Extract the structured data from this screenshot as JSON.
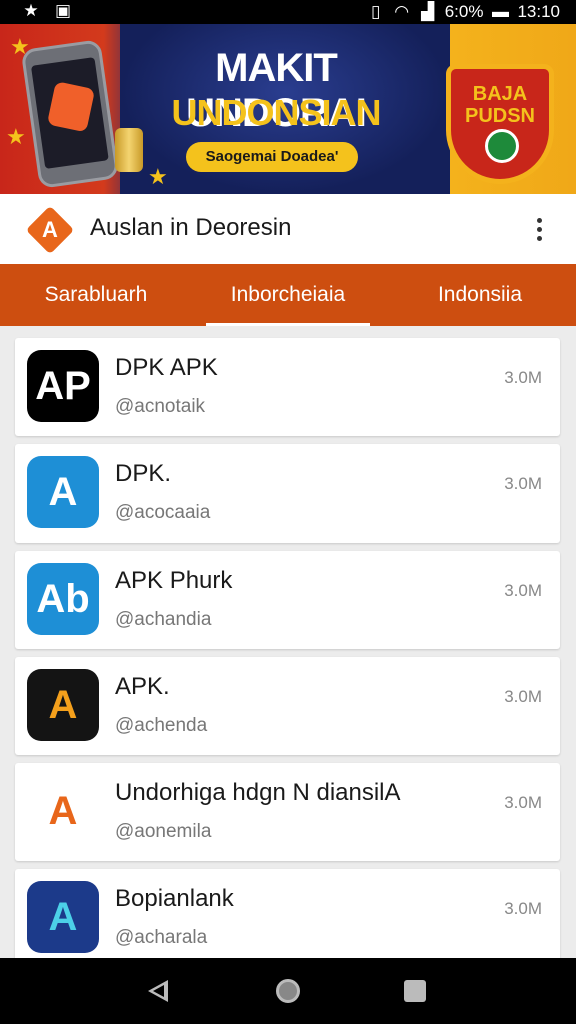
{
  "status_bar": {
    "battery": "6:0%",
    "time": "13:10",
    "icons": [
      "notification-icon",
      "image-icon",
      "vibrate-icon",
      "wifi-icon",
      "signal-icon",
      "battery-icon"
    ]
  },
  "banner": {
    "title_line1": "MAKIT UNDORAI",
    "title_line2": "UNDONSIAN",
    "pill_text": "Saogemai Doadea'",
    "shield_text_line1": "BAJA",
    "shield_text_line2": "PUDSN"
  },
  "app_header": {
    "logo_letter": "A",
    "title": "Auslan in Deoresin",
    "menu_icon": "more-vertical-icon"
  },
  "tabs": [
    {
      "label": "Sarabluarh",
      "active": false
    },
    {
      "label": "Inborcheiaia",
      "active": true
    },
    {
      "label": "Indonsiia",
      "active": false
    }
  ],
  "apps": [
    {
      "name": "DPK APK",
      "developer": "@acnotaik",
      "size": "3.0M",
      "icon_text": "AP",
      "icon_bg": "#000000",
      "icon_color": "#ffffff"
    },
    {
      "name": "DPK.",
      "developer": "@acocaaia",
      "size": "3.0M",
      "icon_text": "A",
      "icon_bg": "#1e8fd6",
      "icon_color": "#ffffff"
    },
    {
      "name": "APK Phurk",
      "developer": "@achandia",
      "size": "3.0M",
      "icon_text": "Ab",
      "icon_bg": "#1e8fd6",
      "icon_color": "#ffffff"
    },
    {
      "name": "APK.",
      "developer": "@achenda",
      "size": "3.0M",
      "icon_text": "A",
      "icon_bg": "#141414",
      "icon_color": "#f4a01c"
    },
    {
      "name": "Undorhiga hdgn N diansilA",
      "developer": "@aonemila",
      "size": "3.0M",
      "icon_text": "A",
      "icon_bg": "#ffffff",
      "icon_color": "#e8661a"
    },
    {
      "name": "Bopianlank",
      "developer": "@acharala",
      "size": "3.0M",
      "icon_text": "A",
      "icon_bg": "#1c3a8a",
      "icon_color": "#4cd0e8"
    }
  ],
  "nav": {
    "back_icon": "back-triangle-icon",
    "home_icon": "home-circle-icon",
    "recents_icon": "recents-square-icon"
  }
}
